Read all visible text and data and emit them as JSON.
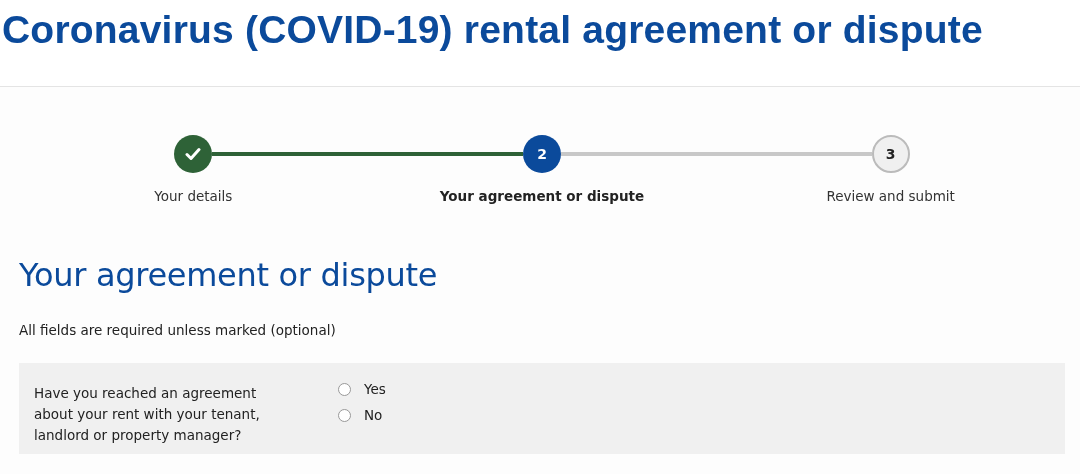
{
  "page_title": "Coronavirus (COVID-19) rental agreement or dispute",
  "steps": [
    {
      "label": "Your details",
      "completed": true,
      "selected": false
    },
    {
      "label": "Your agreement or dispute",
      "marker": "2",
      "completed": false,
      "selected": true
    },
    {
      "label": "Review and submit",
      "marker": "3",
      "completed": false,
      "selected": false
    }
  ],
  "section_heading": "Your agreement or dispute",
  "intro": "All fields are required unless marked (optional)",
  "question": {
    "label": "Have you reached an agreement about your rent with your tenant, landlord or property manager?",
    "options": [
      {
        "label": "Yes",
        "selected": false
      },
      {
        "label": "No",
        "selected": false
      }
    ]
  }
}
